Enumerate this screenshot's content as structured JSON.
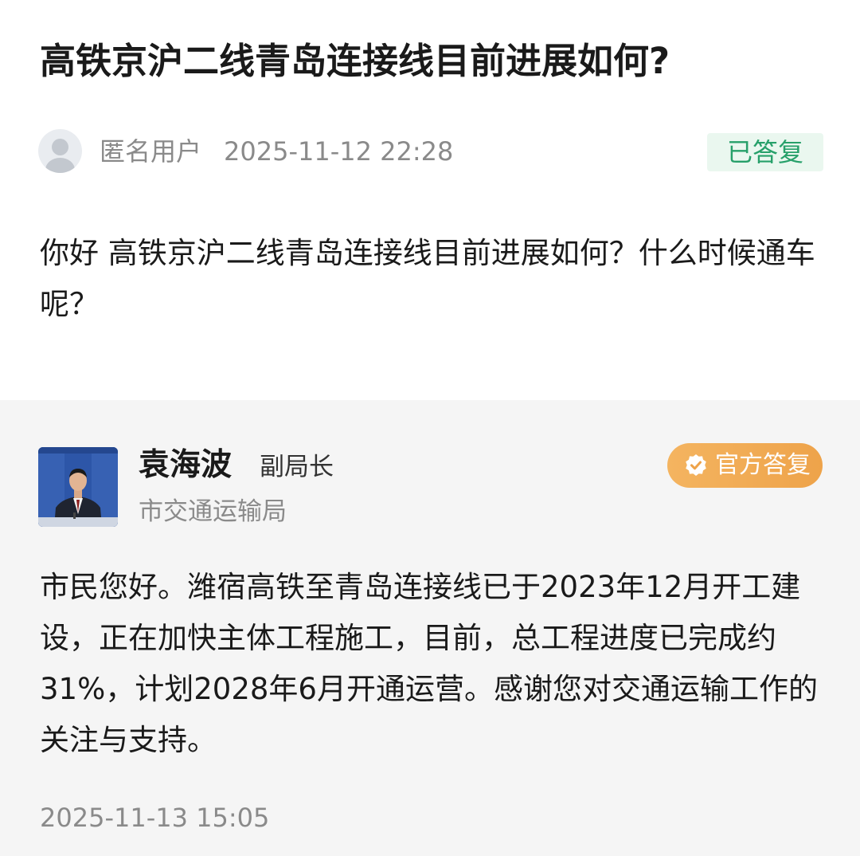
{
  "question": {
    "title": "高铁京沪二线青岛连接线目前进展如何?",
    "asker_name": "匿名用户",
    "asked_at": "2025-11-12 22:28",
    "status": "已答复",
    "body": "你好 高铁京沪二线青岛连接线目前进展如何？什么时候通车呢？"
  },
  "answer": {
    "responder_name": "袁海波",
    "responder_title": "副局长",
    "responder_org": "市交通运输局",
    "official_badge": "官方答复",
    "body": "市民您好。潍宿高铁至青岛连接线已于2023年12月开工建设，正在加快主体工程施工，目前，总工程进度已完成约31%，计划2028年6月开通运营。感谢您对交通运输工作的关注与支持。",
    "answered_at": "2025-11-13 15:05"
  },
  "colors": {
    "status_green": "#27a06a",
    "badge_orange": "#eea34a",
    "answer_bg": "#f5f5f5"
  },
  "icons": {
    "asker_avatar": "anonymous-user-icon",
    "official_badge": "verified-check-icon"
  }
}
